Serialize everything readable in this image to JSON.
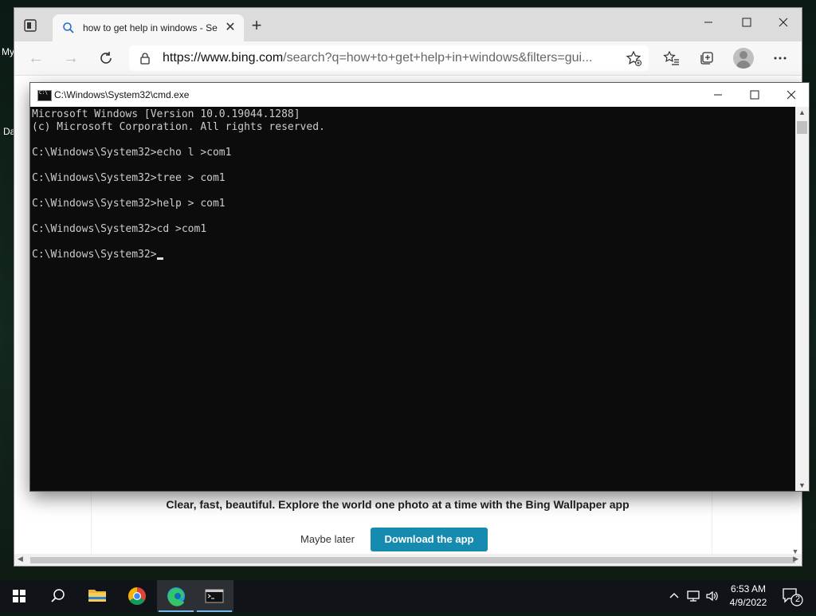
{
  "desktop": {
    "label_1": "My",
    "label_2": "Da"
  },
  "browser": {
    "tab_title": "how to get help in windows - Se",
    "url_domain": "https://www.bing.com",
    "url_rest": "/search?q=how+to+get+help+in+windows&filters=gui...",
    "page": {
      "promo_text": "Clear, fast, beautiful. Explore the world one photo at a time with the Bing Wallpaper app",
      "maybe_later": "Maybe later",
      "download": "Download the app"
    }
  },
  "cmd": {
    "title": "C:\\Windows\\System32\\cmd.exe",
    "lines": [
      "Microsoft Windows [Version 10.0.19044.1288]",
      "(c) Microsoft Corporation. All rights reserved.",
      "",
      "C:\\Windows\\System32>echo l >com1",
      "",
      "C:\\Windows\\System32>tree > com1",
      "",
      "C:\\Windows\\System32>help > com1",
      "",
      "C:\\Windows\\System32>cd >com1",
      "",
      "C:\\Windows\\System32>"
    ]
  },
  "taskbar": {
    "time": "6:53 AM",
    "date": "4/9/2022",
    "notification_count": "2"
  },
  "colors": {
    "accent": "#168bb0",
    "console_bg": "#0c0c0c",
    "taskbar_bg": "#101418"
  }
}
